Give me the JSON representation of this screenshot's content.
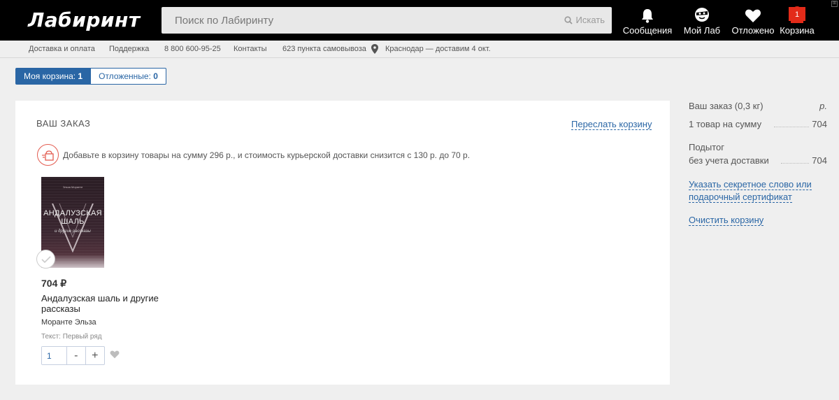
{
  "header": {
    "logo": "Лабиринт",
    "search": {
      "placeholder": "Поиск по Лабиринту",
      "button_label": "Искать"
    },
    "nav": {
      "messages": "Сообщения",
      "my_lab": "Мой Лаб",
      "deferred": "Отложено",
      "cart": "Корзина",
      "cart_count": "1"
    }
  },
  "subnav": {
    "delivery": "Доставка и оплата",
    "support": "Поддержка",
    "phone": "8 800 600-95-25",
    "contacts": "Контакты",
    "pickup": "623 пункта самовывоза",
    "location": "Краснодар — доставим 4 окт."
  },
  "tabs": {
    "cart_label": "Моя корзина:",
    "cart_count": "1",
    "deferred_label": "Отложенные:",
    "deferred_count": "0"
  },
  "order": {
    "title": "ВАШ ЗАКАЗ",
    "forward_link": "Переслать корзину",
    "promo": "Добавьте в корзину товары на сумму 296 р., и стоимость курьерской доставки снизится с 130 р. до 70 р."
  },
  "item": {
    "cover": {
      "author": "Эльза Моранте",
      "title_line1": "АНДАЛУЗСКАЯ",
      "title_line2": "ШАЛЬ",
      "subtitle": "и другие рассказы"
    },
    "price": "704 ₽",
    "title": "Андалузская шаль и другие рассказы",
    "author": "Моранте Эльза",
    "translator": "Текст: Первый ряд",
    "quantity": "1",
    "minus": "-",
    "plus": "+"
  },
  "summary": {
    "order_label": "Ваш заказ (0,3 кг)",
    "currency": "р.",
    "items_label": "1 товар на сумму",
    "items_sum": "704",
    "subtotal_line1": "Подытог",
    "subtotal_line2": "без учета доставки",
    "subtotal_sum": "704",
    "secret_link": "Указать секретное слово или подарочный сертификат",
    "clear_link": "Очистить корзину"
  },
  "colors": {
    "accent": "#2a66a5",
    "header_bg": "#000000",
    "cart_badge": "#e32b19",
    "promo_icon": "#e35b4f"
  }
}
